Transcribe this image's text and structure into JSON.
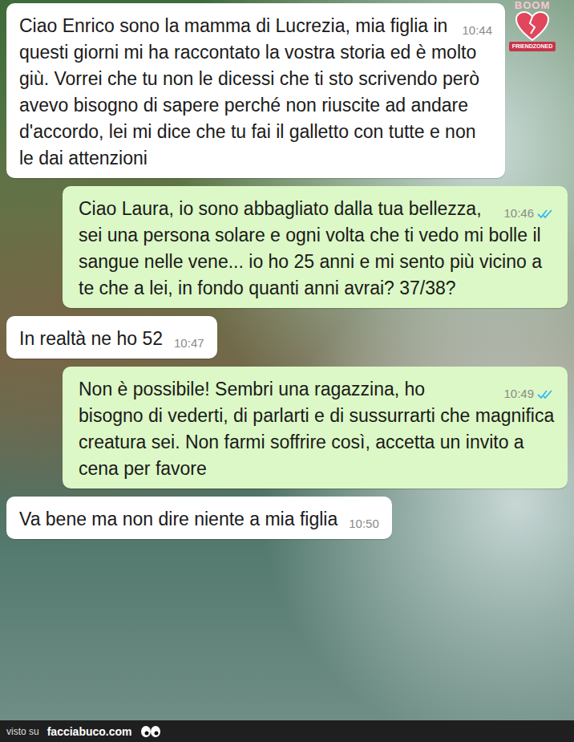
{
  "watermark": {
    "top": "BOOM",
    "bottom": "FRIENDZONED"
  },
  "messages": [
    {
      "kind": "incoming",
      "text": "Ciao Enrico sono la mamma di Lucrezia, mia figlia in questi giorni mi ha raccontato la vostra storia ed è molto giù. Vorrei che tu non le dicessi che ti sto scrivendo però avevo bisogno di sapere perché non riuscite ad andare d'accordo, lei mi dice che tu fai il galletto con tutte e non le dai attenzioni",
      "time": "10:44"
    },
    {
      "kind": "outgoing",
      "text": "Ciao Laura, io sono abbagliato dalla tua bellezza, sei una persona solare e ogni volta che ti vedo mi bolle il sangue nelle vene... io ho 25 anni e mi sento più vicino a te che a lei, in fondo quanti anni avrai? 37/38?",
      "time": "10:46",
      "read": true
    },
    {
      "kind": "incoming",
      "text": "In realtà ne ho 52",
      "time": "10:47"
    },
    {
      "kind": "outgoing",
      "text": "Non è possibile! Sembri una ragazzina, ho bisogno di vederti, di parlarti e di sussurrarti che magnifica creatura sei. Non farmi soffrire così, accetta un invito a cena per favore",
      "time": "10:49",
      "read": true
    },
    {
      "kind": "incoming",
      "text": "Va bene ma non dire niente a mia figlia",
      "time": "10:50"
    }
  ],
  "footer": {
    "prefix": "visto su",
    "site": "facciabuco.com"
  }
}
